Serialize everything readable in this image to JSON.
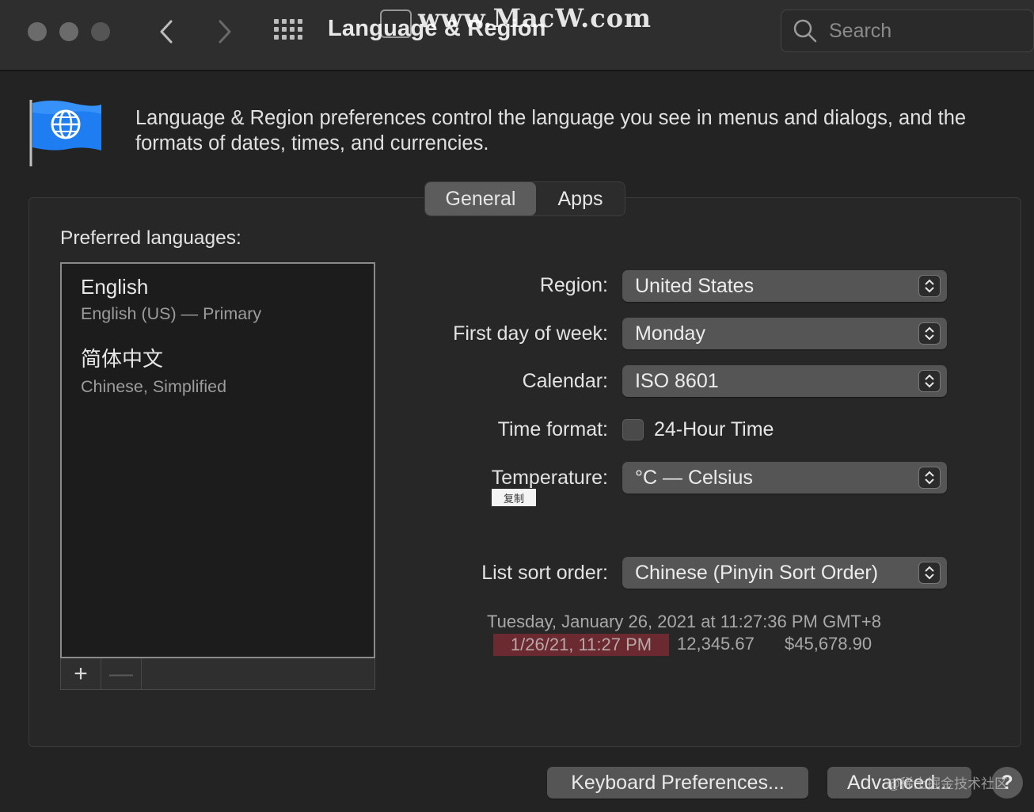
{
  "window": {
    "title": "Language & Region"
  },
  "watermark": {
    "text": "www.MacW.com"
  },
  "search": {
    "placeholder": "Search"
  },
  "header": {
    "description": "Language & Region preferences control the language you see in menus and dialogs, and the formats of dates, times, and currencies."
  },
  "tabs": [
    {
      "label": "General",
      "active": true
    },
    {
      "label": "Apps",
      "active": false
    }
  ],
  "languages": {
    "heading": "Preferred languages:",
    "items": [
      {
        "name": "English",
        "detail": "English (US) — Primary"
      },
      {
        "name": "简体中文",
        "detail": "Chinese, Simplified"
      }
    ],
    "add_label": "+",
    "remove_label": "—"
  },
  "form": {
    "region": {
      "label": "Region:",
      "value": "United States"
    },
    "first_day": {
      "label": "First day of week:",
      "value": "Monday"
    },
    "calendar": {
      "label": "Calendar:",
      "value": "ISO 8601"
    },
    "time_format": {
      "label": "Time format:",
      "checkbox_label": "24-Hour Time",
      "checked": false
    },
    "temperature": {
      "label": "Temperature:",
      "value": "°C — Celsius"
    },
    "copy_tag": "复制",
    "sort_order": {
      "label": "List sort order:",
      "value": "Chinese (Pinyin Sort Order)"
    }
  },
  "samples": {
    "date_long": "Tuesday, January 26, 2021 at 11:27:36 PM GMT+8",
    "date_short": "1/26/21, 11:27 PM",
    "number": "12,345.67",
    "currency": "$45,678.90"
  },
  "buttons": {
    "keyboard": "Keyboard Preferences...",
    "advanced": "Advanced...",
    "help": "?"
  },
  "credit": "@稀土掘金技术社区",
  "colors": {
    "background": "#232323",
    "titlebar": "#2e2e2e",
    "popup": "#555555",
    "highlight": "#6a2a30",
    "flag_blue": "#1e7df0"
  }
}
